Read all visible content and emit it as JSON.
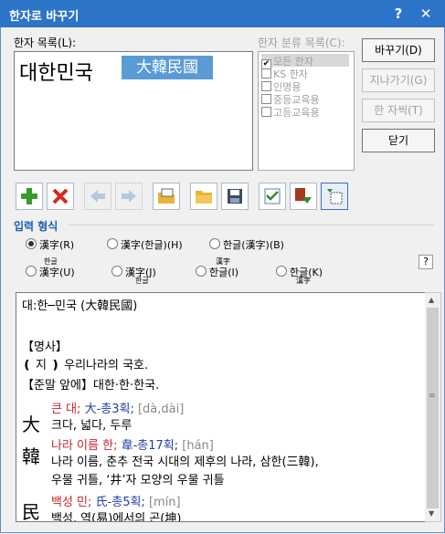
{
  "window": {
    "title": "한자로 바꾸기",
    "help_glyph": "?",
    "close_glyph": "✕"
  },
  "hanja_list": {
    "label": "한자 목록(L):",
    "korean_word": "대한민국",
    "selected_hanja": "大韓民國"
  },
  "category_list": {
    "label": "한자 분류 목록(C):",
    "items": [
      {
        "label": "모든 한자",
        "checked": true
      },
      {
        "label": "KS 한자",
        "checked": false
      },
      {
        "label": "인명용",
        "checked": false
      },
      {
        "label": "중등교육용",
        "checked": false
      },
      {
        "label": "고등교육용",
        "checked": false
      }
    ]
  },
  "buttons": {
    "convert": "바꾸기(D)",
    "skip": "지나가기(G)",
    "one_char": "한 자씩(T)",
    "close": "닫기"
  },
  "toolbar": [
    "add-icon",
    "delete-icon",
    "arrow-left-icon",
    "arrow-right-icon",
    "open-dictionary-icon",
    "open-folder-icon",
    "save-icon",
    "checklist-icon",
    "register-icon",
    "options-icon"
  ],
  "input_format": {
    "title": "입력 형식",
    "options_row1": [
      "漢字(R)",
      "漢字(한글)(H)",
      "한글(漢字)(B)"
    ],
    "options_row2": [
      {
        "ruby": "한글",
        "base": "漢字(U)"
      },
      {
        "ruby": "한글",
        "base": "漢字(J)"
      },
      {
        "ruby": "漢字",
        "base": "한글(I)"
      },
      {
        "ruby": "漢字",
        "base": "한글(K)"
      }
    ],
    "help": "?"
  },
  "definition": {
    "headword": "대:한─민국 (大韓民國)",
    "pos": "【명사】",
    "meaning": "❪ 지 ❫ 우리나라의 국호.",
    "abbr": "【준말 앞에】대한·한·한국.",
    "chars": [
      {
        "char": "大",
        "name": "큰 대;",
        "radical": "大-총3획;",
        "reading": "[dà,dài]",
        "meaning": "크다, 넓다, 두루"
      },
      {
        "char": "韓",
        "name": "나라 이름 한;",
        "radical": "韋-총17획;",
        "reading": "[hán]",
        "meaning": "나라 이름, 춘추 전국 시대의 제후의 나라, 삼한(三韓),",
        "meaning2": "우물 귀틀, ‘井’자 모양의 우물 귀틀"
      },
      {
        "char": "民",
        "name": "백성 민;",
        "radical": "氏-총5획;",
        "reading": "[mín]",
        "meaning": "백성, 역(易)에서의 곤(坤)"
      }
    ]
  }
}
